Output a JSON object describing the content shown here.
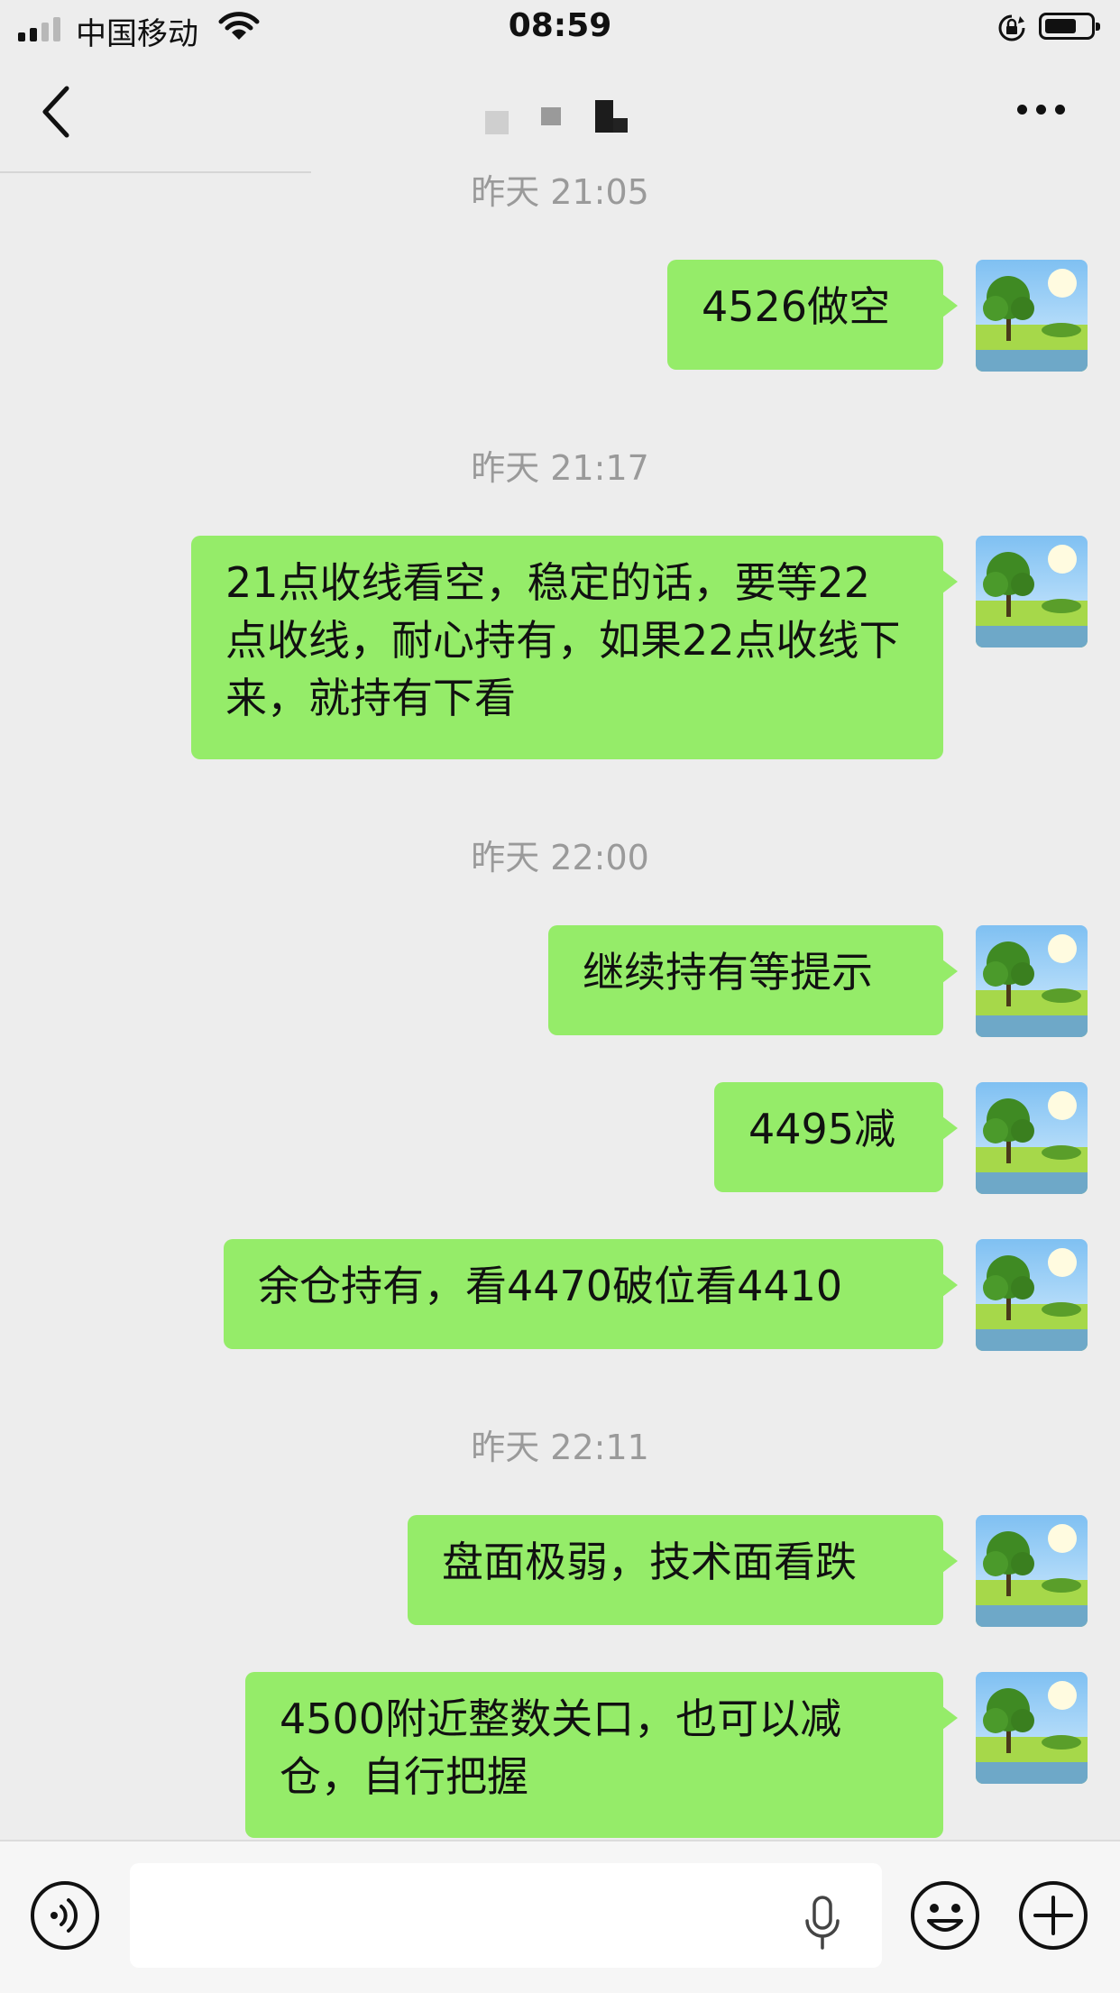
{
  "status_bar": {
    "carrier": "中国移动",
    "time": "08:59"
  },
  "nav": {
    "title": "",
    "back_icon": "chevron-left-icon",
    "more_icon": "more-horizontal-icon"
  },
  "chat": {
    "timestamps": [
      "昨天 21:05",
      "昨天 21:17",
      "昨天 22:00",
      "昨天 22:11"
    ],
    "messages": [
      "4526做空",
      "21点收线看空，稳定的话，要等22点收线，耐心持有，如果22点收线下来，就持有下看",
      "继续持有等提示",
      "4495减",
      "余仓持有，看4470破位看4410",
      "盘面极弱，技术面看跌",
      "4500附近整数关口，也可以减仓，自行把握"
    ],
    "bubble_color": "#95ec69",
    "background_color": "#ededed"
  },
  "input_bar": {
    "placeholder": "",
    "voice_icon": "voice-icon",
    "mic_icon": "microphone-icon",
    "emoji_icon": "emoji-icon",
    "plus_icon": "plus-circle-icon"
  }
}
